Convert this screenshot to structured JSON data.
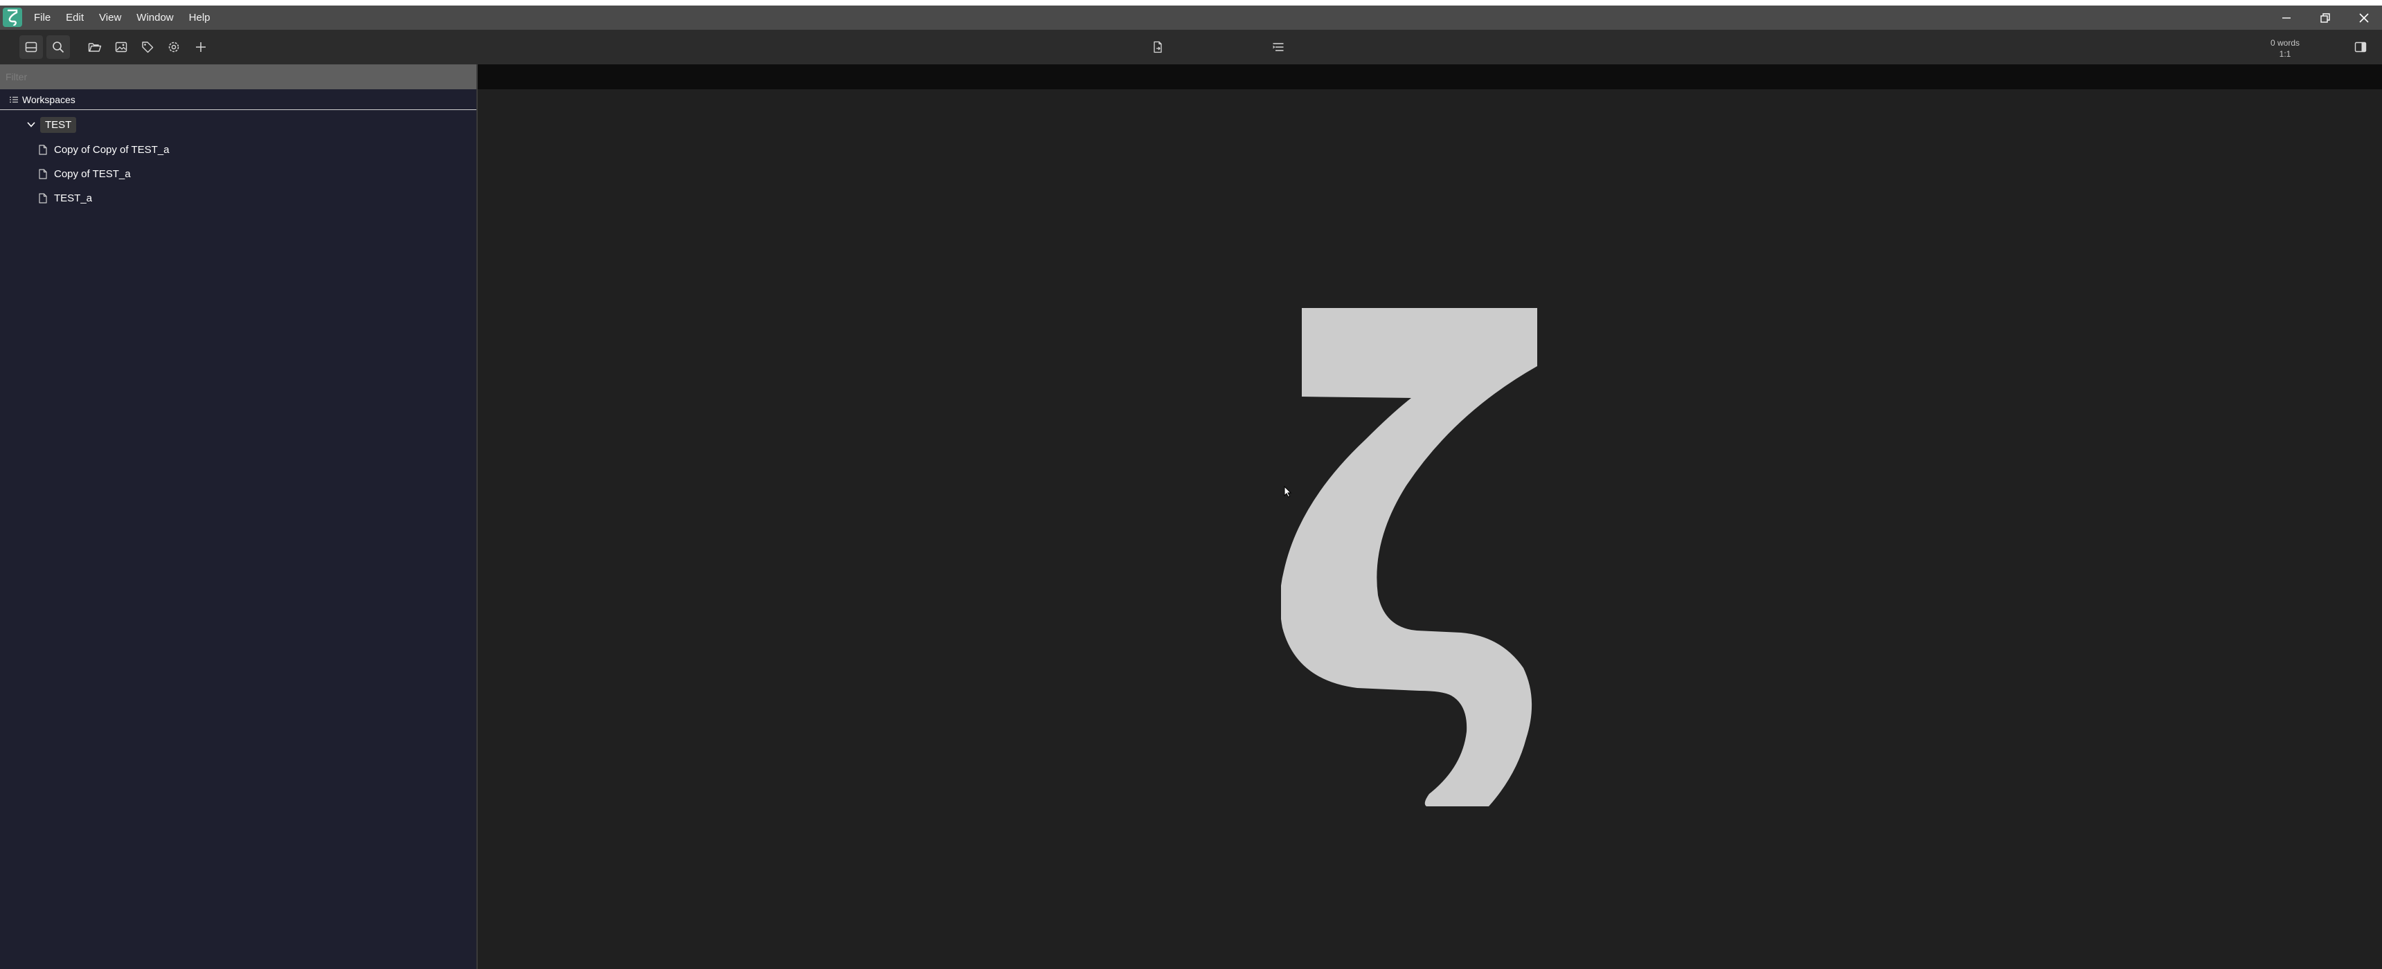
{
  "app": {
    "menu": [
      "File",
      "Edit",
      "View",
      "Window",
      "Help"
    ]
  },
  "toolbar": {
    "buttons": [
      "file-manager-icon",
      "search-icon",
      "open-workspace-icon",
      "image-icon",
      "tag-icon",
      "settings-icon",
      "add-icon",
      "export-icon",
      "table-of-contents-icon",
      "sidebar-toggle-icon"
    ],
    "word_count": "0 words",
    "cursor_position": "1:1"
  },
  "sidebar": {
    "filter_placeholder": "Filter",
    "workspaces_label": "Workspaces",
    "folder": "TEST",
    "files": [
      "Copy of Copy of TEST_a",
      "Copy of TEST_a",
      "TEST_a"
    ]
  },
  "colors": {
    "brand": "#3fa58a",
    "titlebar": "#4a4a4a",
    "toolbar": "#2c2c2c",
    "sidebar": "#1e1f2f",
    "editor": "#202020",
    "logo": "#cccccc"
  }
}
